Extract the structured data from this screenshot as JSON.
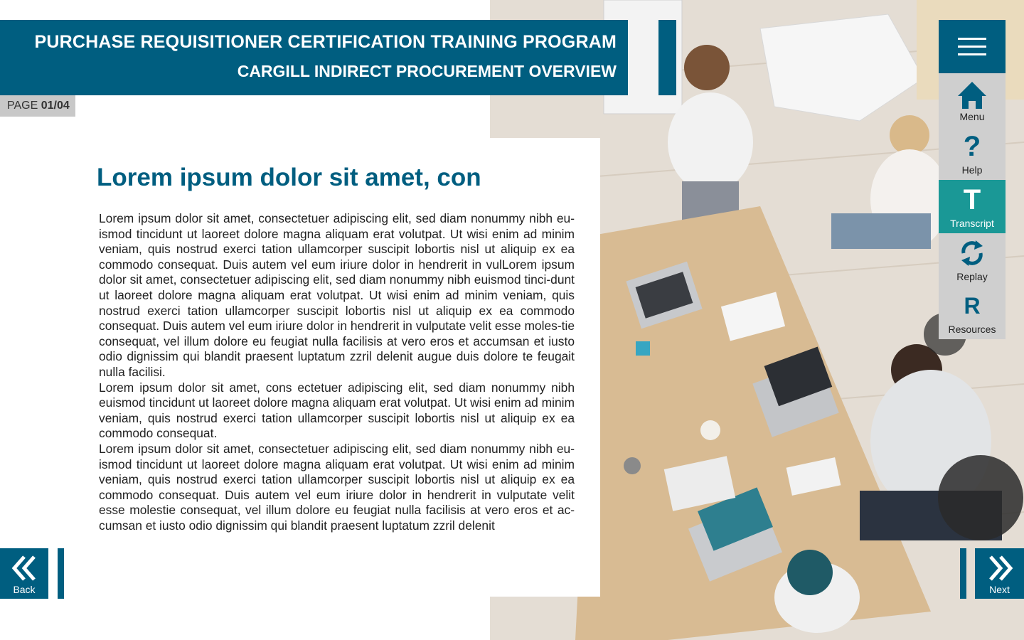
{
  "header": {
    "title": "PURCHASE REQUISITIONER CERTIFICATION TRAINING PROGRAM",
    "subtitle": "CARGILL INDIRECT PROCUREMENT OVERVIEW"
  },
  "page": {
    "label": "PAGE",
    "number": "01/04"
  },
  "article": {
    "title": "Lorem ipsum dolor sit amet, con",
    "paragraphs": [
      "Lorem ipsum dolor sit amet, consectetuer adipiscing elit, sed diam nonummy nibh eu-ismod tincidunt ut laoreet dolore magna aliquam erat volutpat. Ut wisi enim ad minim veniam, quis nostrud exerci tation ullamcorper suscipit lobortis nisl ut aliquip ex ea commodo consequat. Duis autem vel eum iriure dolor in hendrerit in vulLorem ipsum dolor sit amet, consectetuer adipiscing elit, sed diam nonummy nibh euismod tinci-dunt ut laoreet dolore magna aliquam erat volutpat. Ut wisi enim ad minim veniam, quis nostrud exerci tation ullamcorper suscipit lobortis nisl ut aliquip ex ea commodo consequat. Duis autem vel eum iriure dolor in hendrerit in vulputate velit esse moles-tie consequat, vel illum dolore eu feugiat nulla facilisis at vero eros et accumsan et iusto odio dignissim qui blandit praesent luptatum zzril delenit augue duis dolore te feugait nulla facilisi.",
      "Lorem ipsum dolor sit amet, cons ectetuer adipiscing elit, sed diam nonummy nibh euismod tincidunt ut laoreet dolore magna aliquam erat volutpat. Ut wisi enim ad minim veniam, quis nostrud exerci tation ullamcorper suscipit lobortis nisl ut aliquip ex ea commodo consequat.",
      "Lorem ipsum dolor sit amet, consectetuer adipiscing elit, sed diam nonummy nibh eu-ismod tincidunt ut laoreet dolore magna aliquam erat volutpat. Ut wisi enim ad minim veniam, quis nostrud exerci tation ullamcorper suscipit lobortis nisl ut aliquip ex ea commodo consequat. Duis autem vel eum iriure dolor in hendrerit in vulputate velit esse molestie consequat, vel illum dolore eu feugiat nulla facilisis at vero eros et ac-cumsan et iusto odio dignissim qui blandit praesent luptatum zzril delenit"
    ]
  },
  "nav": {
    "hamburger_icon": "hamburger-menu-icon",
    "items": [
      {
        "label": "Menu",
        "icon": "home-icon",
        "glyph": ""
      },
      {
        "label": "Help",
        "icon": "question-icon",
        "glyph": "?"
      },
      {
        "label": "Transcript",
        "icon": "transcript-icon",
        "glyph": "T",
        "active": true
      },
      {
        "label": "Replay",
        "icon": "replay-icon",
        "glyph": ""
      },
      {
        "label": "Resources",
        "icon": "resources-icon",
        "glyph": "R"
      }
    ]
  },
  "footer": {
    "back_label": "Back",
    "next_label": "Next"
  },
  "colors": {
    "primary": "#005e80",
    "active": "#1a9896",
    "nav_bg": "#cfcfcf",
    "badge_bg": "#c8c8c8"
  }
}
